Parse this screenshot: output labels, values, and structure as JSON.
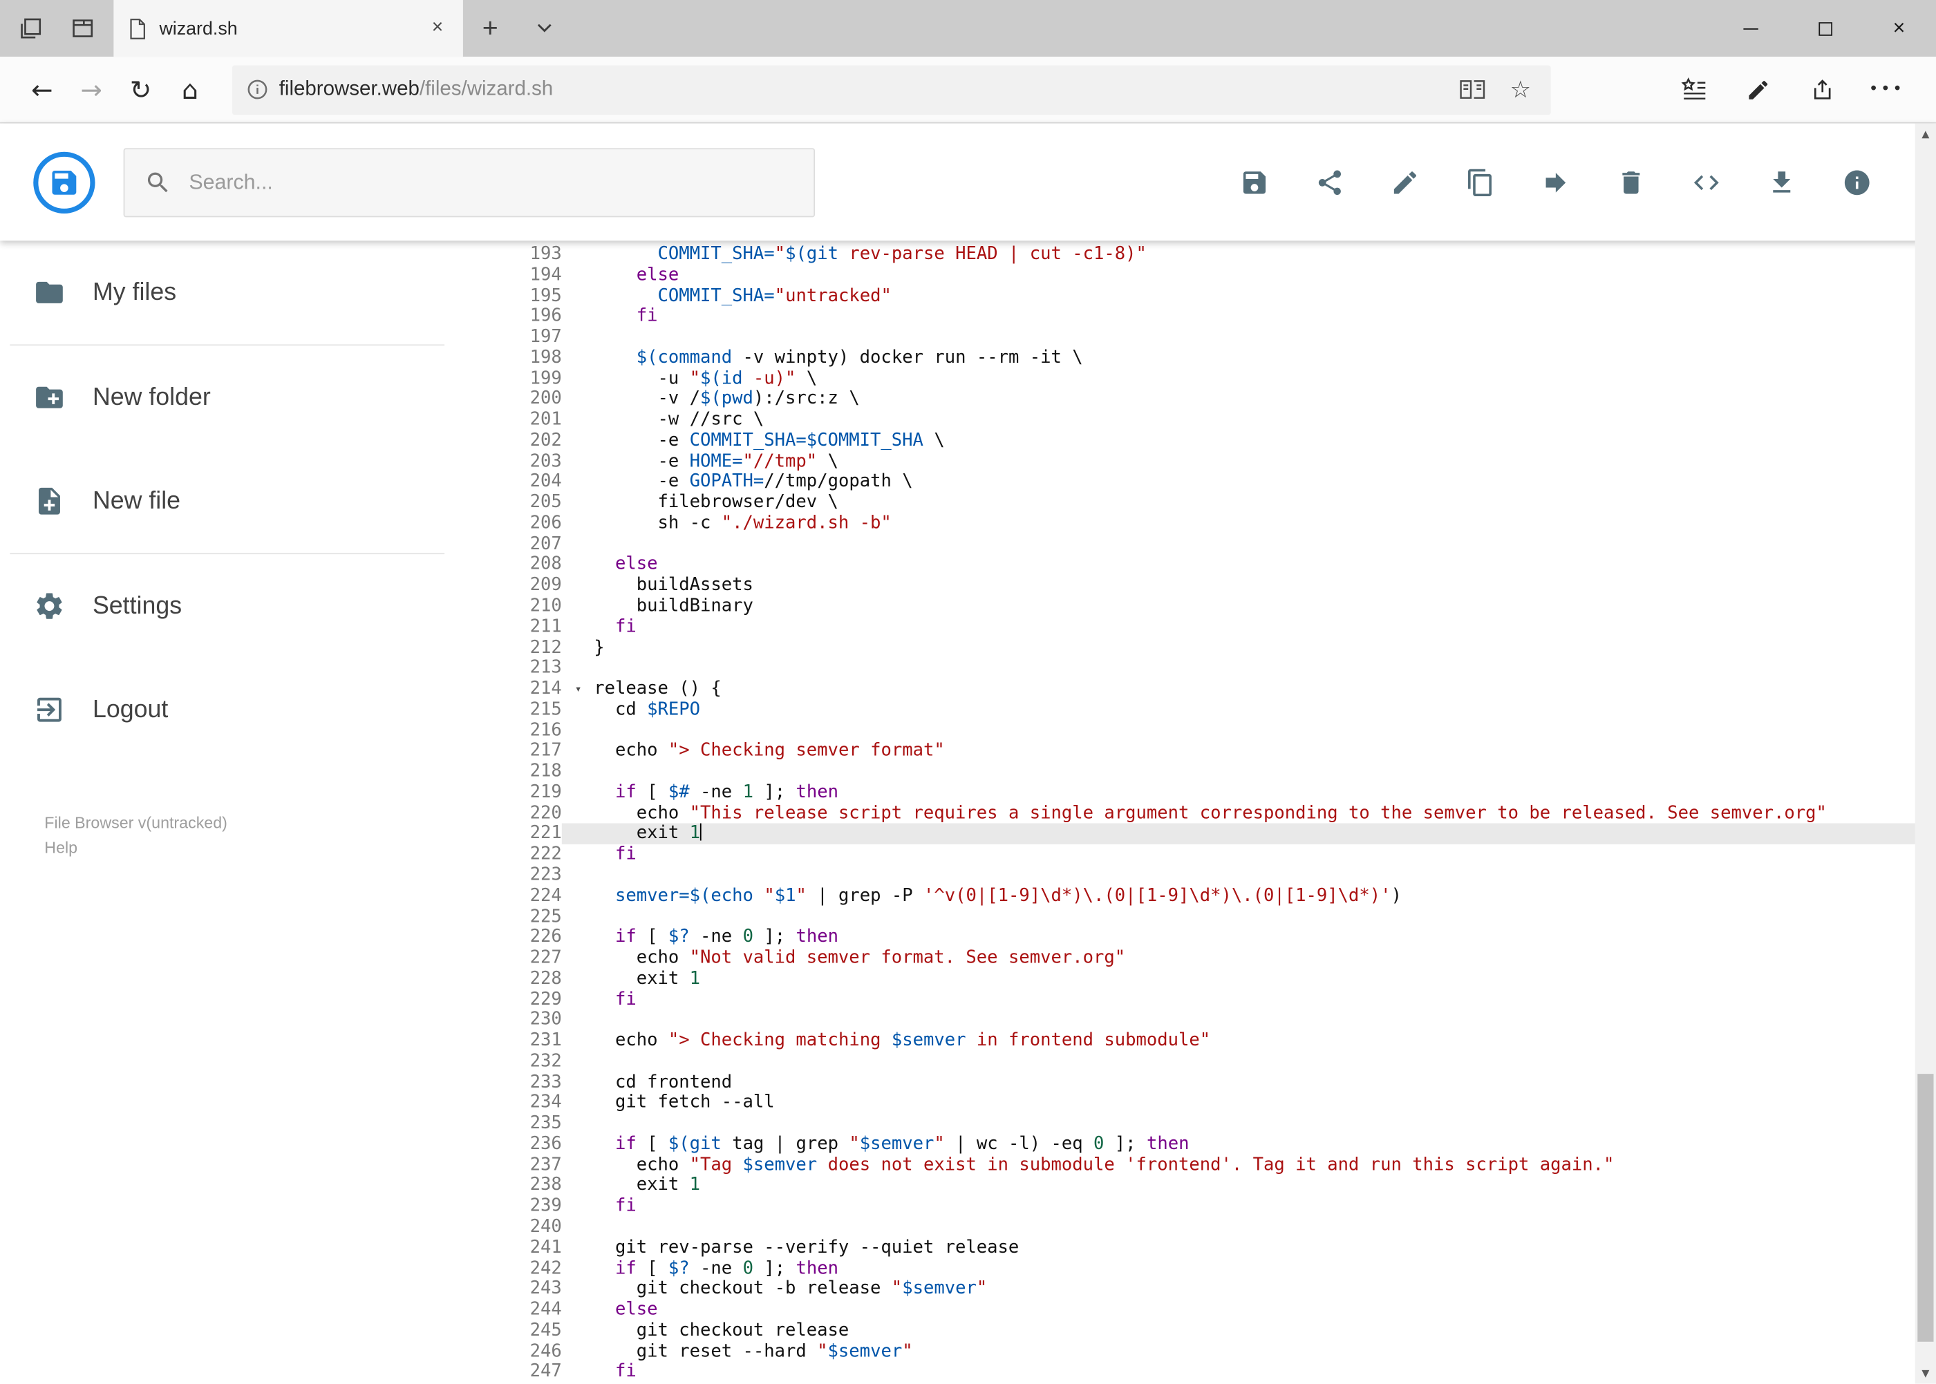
{
  "browser": {
    "tab_title": "wizard.sh",
    "url_host": "filebrowser.web",
    "url_path": "/files/wizard.sh"
  },
  "icons": {
    "back": "←",
    "forward": "→",
    "refresh": "↻",
    "home": "⌂",
    "favorite": "☆",
    "close": "×",
    "new_tab": "+",
    "menu_dots": "•••",
    "scroll_up": "▲",
    "scroll_down": "▼",
    "fold_marker": "▾"
  },
  "app": {
    "search_placeholder": "Search...",
    "toolbar_buttons": [
      "save",
      "share",
      "rename",
      "copy",
      "move",
      "delete",
      "switch-view",
      "download",
      "info"
    ],
    "sidebar": {
      "items": [
        {
          "label": "My files"
        },
        {
          "label": "New folder"
        },
        {
          "label": "New file"
        },
        {
          "label": "Settings"
        },
        {
          "label": "Logout"
        }
      ],
      "version": "File Browser v(untracked)",
      "help": "Help"
    }
  },
  "editor": {
    "first_line": 193,
    "active_line": 221,
    "fold_line": 214,
    "lines": [
      "      COMMIT_SHA=\"$(git rev-parse HEAD | cut -c1-8)\"",
      "    else",
      "      COMMIT_SHA=\"untracked\"",
      "    fi",
      "",
      "    $(command -v winpty) docker run --rm -it \\",
      "      -u \"$(id -u)\" \\",
      "      -v /$(pwd):/src:z \\",
      "      -w //src \\",
      "      -e COMMIT_SHA=$COMMIT_SHA \\",
      "      -e HOME=\"//tmp\" \\",
      "      -e GOPATH=//tmp/gopath \\",
      "      filebrowser/dev \\",
      "      sh -c \"./wizard.sh -b\"",
      "",
      "  else",
      "    buildAssets",
      "    buildBinary",
      "  fi",
      "}",
      "",
      "release () {",
      "  cd $REPO",
      "",
      "  echo \"> Checking semver format\"",
      "",
      "  if [ $# -ne 1 ]; then",
      "    echo \"This release script requires a single argument corresponding to the semver to be released. See semver.org\"",
      "    exit 1",
      "  fi",
      "",
      "  semver=$(echo \"$1\" | grep -P '^v(0|[1-9]\\d*)\\.(0|[1-9]\\d*)\\.(0|[1-9]\\d*)')",
      "",
      "  if [ $? -ne 0 ]; then",
      "    echo \"Not valid semver format. See semver.org\"",
      "    exit 1",
      "  fi",
      "",
      "  echo \"> Checking matching $semver in frontend submodule\"",
      "",
      "  cd frontend",
      "  git fetch --all",
      "",
      "  if [ $(git tag | grep \"$semver\" | wc -l) -eq 0 ]; then",
      "    echo \"Tag $semver does not exist in submodule 'frontend'. Tag it and run this script again.\"",
      "    exit 1",
      "  fi",
      "",
      "  git rev-parse --verify --quiet release",
      "  if [ $? -ne 0 ]; then",
      "    git checkout -b release \"$semver\"",
      "  else",
      "    git checkout release",
      "    git reset --hard \"$semver\"",
      "  fi"
    ]
  },
  "colors": {
    "accent": "#1e88e5",
    "icon_gray": "#546e7a",
    "syntax_keyword": "#770088",
    "syntax_string": "#aa1111",
    "syntax_variable": "#0055aa",
    "syntax_number": "#116644",
    "active_line_bg": "#e9e9e9"
  }
}
